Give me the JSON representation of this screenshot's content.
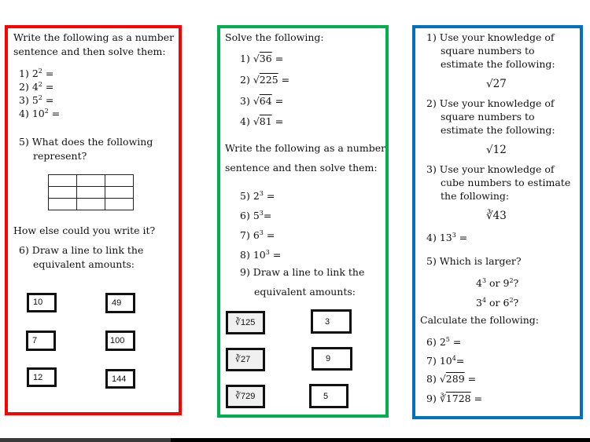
{
  "colors": {
    "red_panel": "#ff0000",
    "green_panel": "#00b050",
    "blue_panel": "#0070c0"
  },
  "red": {
    "intro_1": "Write the following as a number",
    "intro_2": "sentence and then solve them:",
    "q1": {
      "num": "1)",
      "base": "2",
      "exp": "2",
      "tail": " ="
    },
    "q2": {
      "num": "2)",
      "base": "4",
      "exp": "2",
      "tail": " ="
    },
    "q3": {
      "num": "3)",
      "base": "5",
      "exp": "2",
      "tail": " ="
    },
    "q4": {
      "num": "4)",
      "base": "10",
      "exp": "2",
      "tail": " ="
    },
    "q5_1": "5) What does the following",
    "q5_2": "represent?",
    "grid": {
      "rows": 3,
      "cols": 3
    },
    "how_else": "How else could you write it?",
    "q6_1": "6) Draw a line to link the",
    "q6_2": "equivalent amounts:",
    "left_boxes": [
      "10",
      "7",
      "12"
    ],
    "right_boxes": [
      "49",
      "100",
      "144"
    ]
  },
  "green": {
    "intro": "Solve the following:",
    "sqrt": [
      {
        "num": "1)",
        "radicand": "36"
      },
      {
        "num": "2)",
        "radicand": "225"
      },
      {
        "num": "3)",
        "radicand": "64"
      },
      {
        "num": "4)",
        "radicand": "81"
      }
    ],
    "intro2_1": "Write the following as a number",
    "intro2_2": "sentence and then solve them:",
    "cubes": [
      {
        "num": "5)",
        "base": "2",
        "exp": "3"
      },
      {
        "num": "6)",
        "base": "5",
        "exp": "3"
      },
      {
        "num": "7)",
        "base": "6",
        "exp": "3"
      },
      {
        "num": "8)",
        "base": "10",
        "exp": "3"
      }
    ],
    "q9_1": "9) Draw a line to link the",
    "q9_2": "equivalent amounts:",
    "left_boxes": [
      "∛125",
      "∛27",
      "∛729"
    ],
    "right_boxes": [
      "3",
      "9",
      "5"
    ]
  },
  "blue": {
    "q1": [
      "1) Use your knowledge of",
      "square numbers to",
      "estimate the following:"
    ],
    "q1_expr": "√27",
    "q2": [
      "2) Use your knowledge of",
      "square numbers to",
      "estimate the following:"
    ],
    "q2_expr": "√12",
    "q3": [
      "3) Use your knowledge of",
      "cube numbers to estimate",
      "the following:"
    ],
    "q3_expr": "∛43",
    "q4": {
      "num": "4)",
      "base": "13",
      "exp": "3",
      "tail": " ="
    },
    "q5": "5) Which is larger?",
    "q5_a": {
      "b1": "4",
      "e1": "3",
      "mid": " or ",
      "b2": "9",
      "e2": "2",
      "tail": "?"
    },
    "q5_b": {
      "b1": "3",
      "e1": "4",
      "mid": " or ",
      "b2": "6",
      "e2": "2",
      "tail": "?"
    },
    "calc": "Calculate the following:",
    "q6": {
      "num": "6)",
      "base": "2",
      "exp": "5",
      "tail": " ="
    },
    "q7": {
      "num": "7)",
      "base": "10",
      "exp": "4",
      "tail": " ="
    },
    "q8": {
      "num": "8)",
      "sym": "√",
      "radicand": "289",
      "tail": " ="
    },
    "q9": {
      "num": "9)",
      "sym": "∛",
      "radicand": "1728",
      "tail": " ="
    }
  },
  "equals": "="
}
